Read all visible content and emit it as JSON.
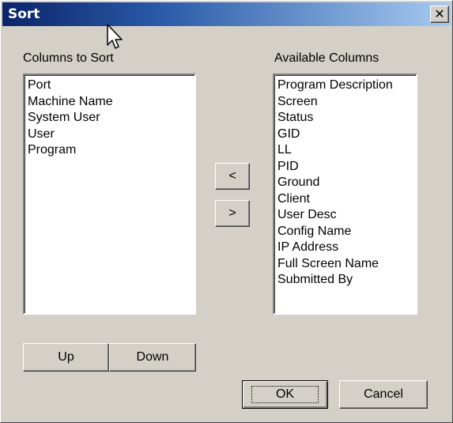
{
  "window": {
    "title": "Sort",
    "close_glyph": "✕"
  },
  "columns_to_sort": {
    "label": "Columns to Sort",
    "items": [
      "Port",
      "Machine Name",
      "System User",
      "User",
      "Program"
    ]
  },
  "available_columns": {
    "label": "Available Columns",
    "items": [
      "Program Description",
      "Screen",
      "Status",
      "GID",
      "LL",
      "PID",
      "Ground",
      "Client",
      "User Desc",
      "Config Name",
      "IP Address",
      "Full Screen Name",
      "Submitted By"
    ]
  },
  "move_buttons": {
    "left_label": "<",
    "right_label": ">"
  },
  "order_buttons": {
    "up_label": "Up",
    "down_label": "Down"
  },
  "dialog_buttons": {
    "ok_label": "OK",
    "cancel_label": "Cancel"
  },
  "colors": {
    "title_gradient_start": "#0a246a",
    "title_gradient_end": "#a6caf0",
    "dialog_face": "#d4d0c8"
  },
  "icons": {
    "cursor": "mouse-pointer-icon"
  }
}
